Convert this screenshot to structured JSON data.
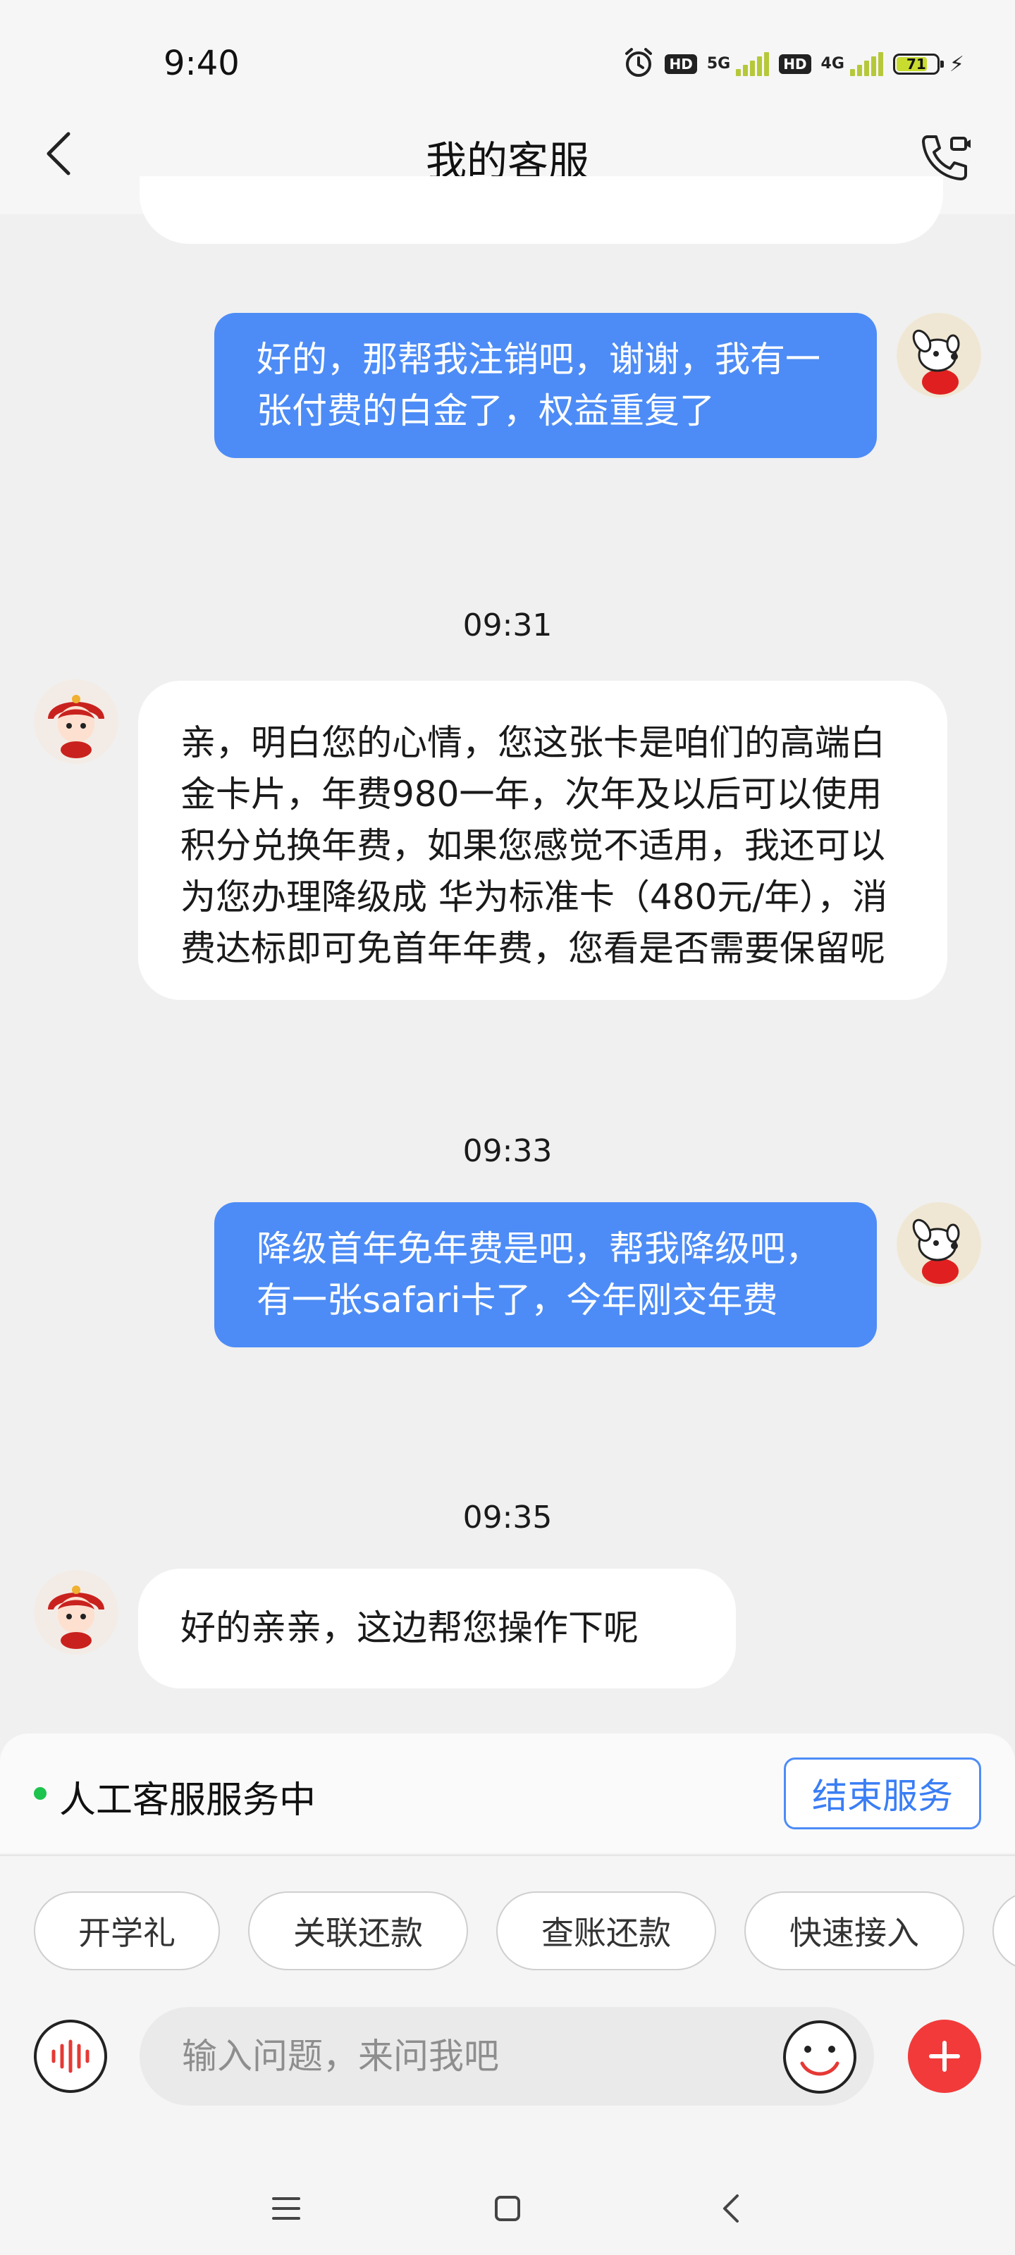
{
  "status_bar": {
    "time": "9:40",
    "hd_label": "HD",
    "network_1": "5G",
    "network_2": "4G",
    "battery_level": "71",
    "icons": [
      "alarm-icon",
      "signal-icon",
      "battery-icon",
      "charging-icon"
    ]
  },
  "header": {
    "title": "我的客服",
    "icons": [
      "back-arrow-icon",
      "phone-call-icon"
    ]
  },
  "messages": [
    {
      "sender": "user",
      "text": "好的，那帮我注销吧，谢谢，我有一张付费的白金了，权益重复了"
    },
    {
      "timestamp": "09:31"
    },
    {
      "sender": "agent",
      "text": "亲，明白您的心情，您这张卡是咱们的高端白金卡片，年费980一年，次年及以后可以使用积分兑换年费，如果您感觉不适用，我还可以为您办理降级成 华为标准卡（480元/年），消费达标即可免首年年费，您看是否需要保留呢"
    },
    {
      "timestamp": "09:33"
    },
    {
      "sender": "user",
      "text": "降级首年免年费是吧，帮我降级吧，有一张safari卡了，今年刚交年费"
    },
    {
      "timestamp": "09:35"
    },
    {
      "sender": "agent",
      "text": "好的亲亲，这边帮您操作下呢"
    }
  ],
  "service": {
    "status": "人工客服服务中",
    "end_button": "结束服务",
    "status_color": "#1cc34d"
  },
  "quick_chips": [
    "开学礼",
    "关联还款",
    "查账还款",
    "快速接入",
    ""
  ],
  "input": {
    "placeholder": "输入问题，来问我吧"
  },
  "colors": {
    "user_bubble": "#4d8cf6",
    "agent_bubble": "#ffffff",
    "background": "#f0f0f0",
    "plus_button": "#f23a3a"
  }
}
